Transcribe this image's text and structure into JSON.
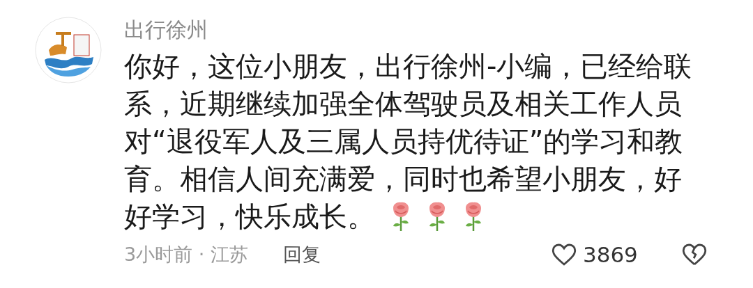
{
  "comment": {
    "author": "出行徐州",
    "text_lines": [
      "你好，这位小朋友，出行徐州-小编，已经给联",
      "系，近期继续加强全体驾驶员及相关工作人员",
      "对“退役军人及三属人员持优待证”的学习和教",
      "育。相信人间充满爱，同时也希望小朋友，好",
      "好学习，快乐成长。"
    ],
    "time_location": "3小时前 · 江苏",
    "reply": "回复",
    "likes": "3869",
    "liked": false
  }
}
